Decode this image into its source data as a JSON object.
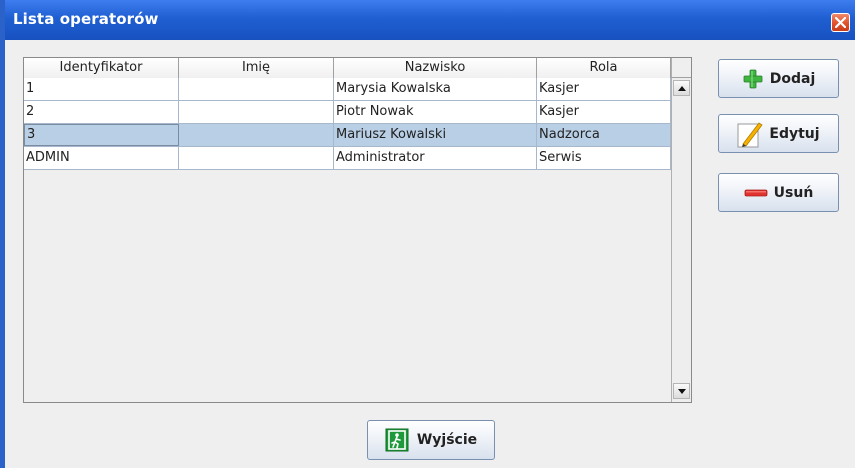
{
  "window": {
    "title": "Lista operatorów"
  },
  "table": {
    "columns": [
      "Identyfikator",
      "Imię",
      "Nazwisko",
      "Rola"
    ],
    "rows": [
      {
        "id": "1",
        "first": "",
        "last": "Marysia Kowalska",
        "role": "Kasjer"
      },
      {
        "id": "2",
        "first": "",
        "last": "Piotr Nowak",
        "role": "Kasjer"
      },
      {
        "id": "3",
        "first": "",
        "last": "Mariusz Kowalski",
        "role": "Nadzorca"
      },
      {
        "id": "ADMIN",
        "first": "",
        "last": "Administrator",
        "role": "Serwis"
      }
    ],
    "selected_row_index": 2
  },
  "buttons": {
    "add": {
      "label": "Dodaj",
      "icon": "plus-icon"
    },
    "edit": {
      "label": "Edytuj",
      "icon": "pencil-icon"
    },
    "delete": {
      "label": "Usuń",
      "icon": "minus-icon"
    },
    "exit": {
      "label": "Wyjście",
      "icon": "exit-icon"
    }
  },
  "colors": {
    "titlebar": "#1f5fd2",
    "selected_row": "#b8cfe5",
    "close": "#e0502c"
  }
}
